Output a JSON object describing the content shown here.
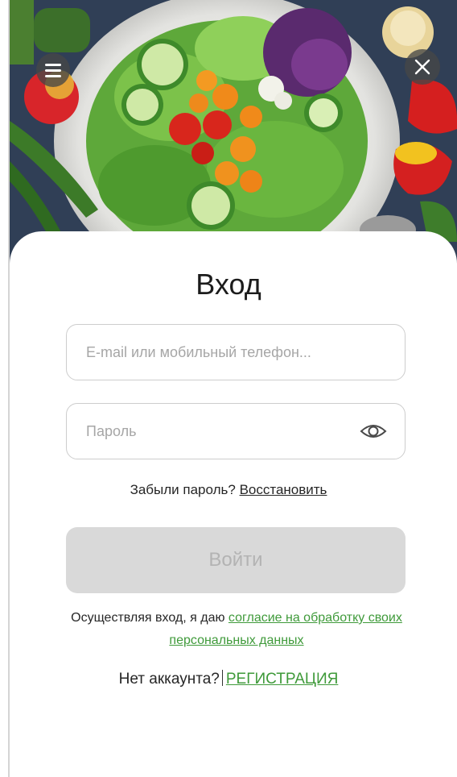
{
  "header": {
    "menu_icon": "hamburger-menu-icon",
    "close_icon": "close-icon"
  },
  "login": {
    "title": "Вход",
    "email_placeholder": "E-mail или мобильный телефон...",
    "password_placeholder": "Пароль",
    "password_toggle_icon": "eye-icon",
    "forgot_text": "Забыли пароль?",
    "forgot_link": "Восстановить",
    "submit_label": "Войти",
    "consent_text": "Осуществляя вход, я даю",
    "consent_link": "согласие на обработку своих персональных данных",
    "no_account_text": "Нет аккаунта?",
    "register_link": "РЕГИСТРАЦИЯ"
  },
  "colors": {
    "accent_link": "#3f9a3a",
    "button_disabled_bg": "#d9d9d9",
    "button_disabled_text": "#b3b3b3"
  }
}
